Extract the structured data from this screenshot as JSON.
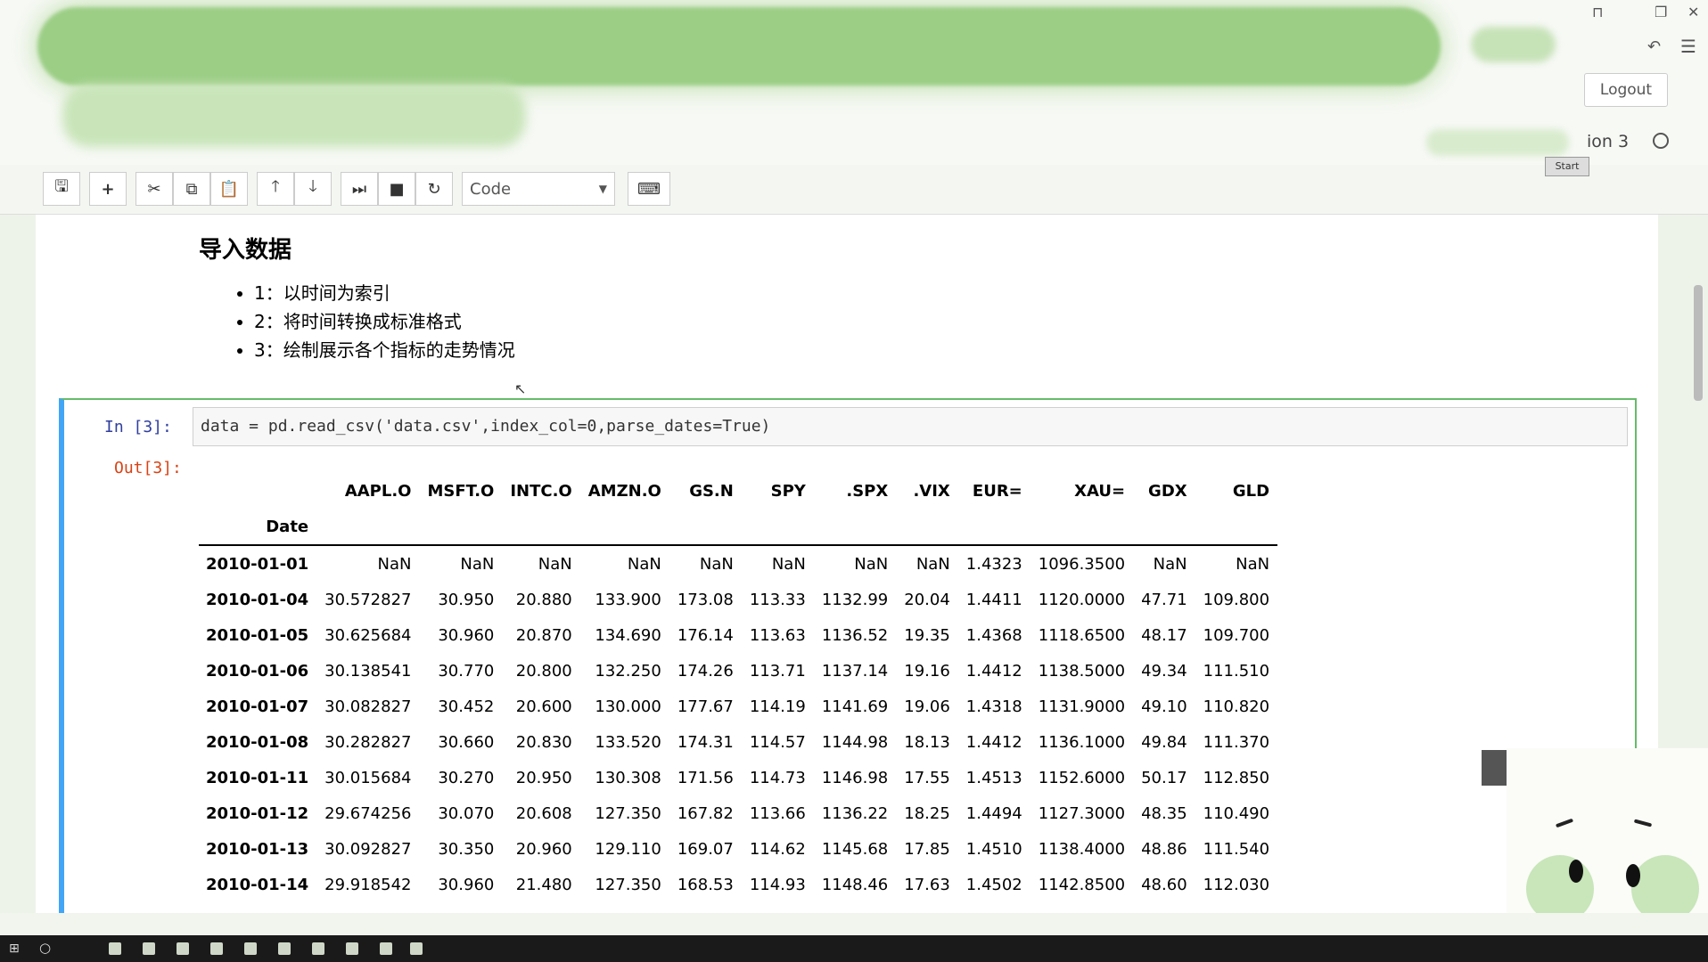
{
  "header": {
    "logout_label": "Logout",
    "kernel_label": "ion 3",
    "start_badge": "Start"
  },
  "toolbar": {
    "cell_type": "Code",
    "icons": [
      "save-icon",
      "plus-icon",
      "scissors-icon",
      "copy-icon",
      "paste-icon",
      "arrow-up-icon",
      "arrow-down-icon",
      "step-forward-icon",
      "stop-icon",
      "restart-icon",
      "keyboard-icon"
    ]
  },
  "markdown": {
    "title": "导入数据",
    "items": [
      "1：以时间为索引",
      "2：将时间转换成标准格式",
      "3：绘制展示各个指标的走势情况"
    ]
  },
  "cell": {
    "in_prompt": "In  [3]:",
    "code": "data = pd.read_csv('data.csv',index_col=0,parse_dates=True)",
    "out_prompt": "Out[3]:"
  },
  "table": {
    "columns": [
      "AAPL.O",
      "MSFT.O",
      "INTC.O",
      "AMZN.O",
      "GS.N",
      "SPY",
      ".SPX",
      ".VIX",
      "EUR=",
      "XAU=",
      "GDX",
      "GLD"
    ],
    "index_name": "Date",
    "rows": [
      {
        "date": "2010-01-01",
        "values": [
          "NaN",
          "NaN",
          "NaN",
          "NaN",
          "NaN",
          "NaN",
          "NaN",
          "NaN",
          "1.4323",
          "1096.3500",
          "NaN",
          "NaN"
        ]
      },
      {
        "date": "2010-01-04",
        "values": [
          "30.572827",
          "30.950",
          "20.880",
          "133.900",
          "173.08",
          "113.33",
          "1132.99",
          "20.04",
          "1.4411",
          "1120.0000",
          "47.71",
          "109.800"
        ]
      },
      {
        "date": "2010-01-05",
        "values": [
          "30.625684",
          "30.960",
          "20.870",
          "134.690",
          "176.14",
          "113.63",
          "1136.52",
          "19.35",
          "1.4368",
          "1118.6500",
          "48.17",
          "109.700"
        ]
      },
      {
        "date": "2010-01-06",
        "values": [
          "30.138541",
          "30.770",
          "20.800",
          "132.250",
          "174.26",
          "113.71",
          "1137.14",
          "19.16",
          "1.4412",
          "1138.5000",
          "49.34",
          "111.510"
        ]
      },
      {
        "date": "2010-01-07",
        "values": [
          "30.082827",
          "30.452",
          "20.600",
          "130.000",
          "177.67",
          "114.19",
          "1141.69",
          "19.06",
          "1.4318",
          "1131.9000",
          "49.10",
          "110.820"
        ]
      },
      {
        "date": "2010-01-08",
        "values": [
          "30.282827",
          "30.660",
          "20.830",
          "133.520",
          "174.31",
          "114.57",
          "1144.98",
          "18.13",
          "1.4412",
          "1136.1000",
          "49.84",
          "111.370"
        ]
      },
      {
        "date": "2010-01-11",
        "values": [
          "30.015684",
          "30.270",
          "20.950",
          "130.308",
          "171.56",
          "114.73",
          "1146.98",
          "17.55",
          "1.4513",
          "1152.6000",
          "50.17",
          "112.850"
        ]
      },
      {
        "date": "2010-01-12",
        "values": [
          "29.674256",
          "30.070",
          "20.608",
          "127.350",
          "167.82",
          "113.66",
          "1136.22",
          "18.25",
          "1.4494",
          "1127.3000",
          "48.35",
          "110.490"
        ]
      },
      {
        "date": "2010-01-13",
        "values": [
          "30.092827",
          "30.350",
          "20.960",
          "129.110",
          "169.07",
          "114.62",
          "1145.68",
          "17.85",
          "1.4510",
          "1138.4000",
          "48.86",
          "111.540"
        ]
      },
      {
        "date": "2010-01-14",
        "values": [
          "29.918542",
          "30.960",
          "21.480",
          "127.350",
          "168.53",
          "114.93",
          "1148.46",
          "17.63",
          "1.4502",
          "1142.8500",
          "48.60",
          "112.030"
        ]
      }
    ]
  }
}
